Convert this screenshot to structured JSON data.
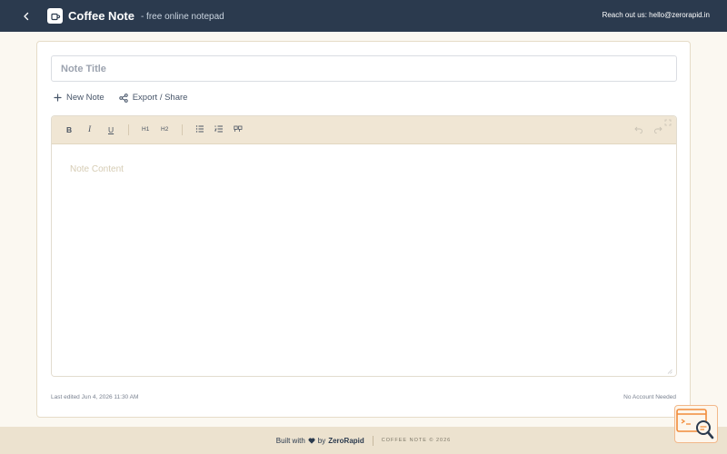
{
  "header": {
    "app_title": "Coffee Note",
    "subtitle": "- free online notepad",
    "contact": "Reach out us: hello@zerorapid.in"
  },
  "note": {
    "title_placeholder": "Note Title",
    "content_placeholder": "Note Content"
  },
  "actions": {
    "new_note": "New Note",
    "export_share": "Export / Share"
  },
  "toolbar": {
    "bold": "B",
    "italic": "I",
    "underline": "U",
    "h1": "H1",
    "h2": "H2"
  },
  "meta": {
    "last_edited": "Last edited Jun 4, 2026 11:30 AM",
    "account": "No Account Needed"
  },
  "footer": {
    "built_with": "Built with",
    "by": "by",
    "brand": "ZeroRapid",
    "copyright": "COFFEE NOTE © 2026"
  },
  "colors": {
    "header_bg": "#2b3a4e",
    "page_bg": "#fbf8f1",
    "toolbar_bg": "#f0e6d4",
    "footer_bg": "#ece2cf",
    "widget_accent": "#f28c3a"
  }
}
